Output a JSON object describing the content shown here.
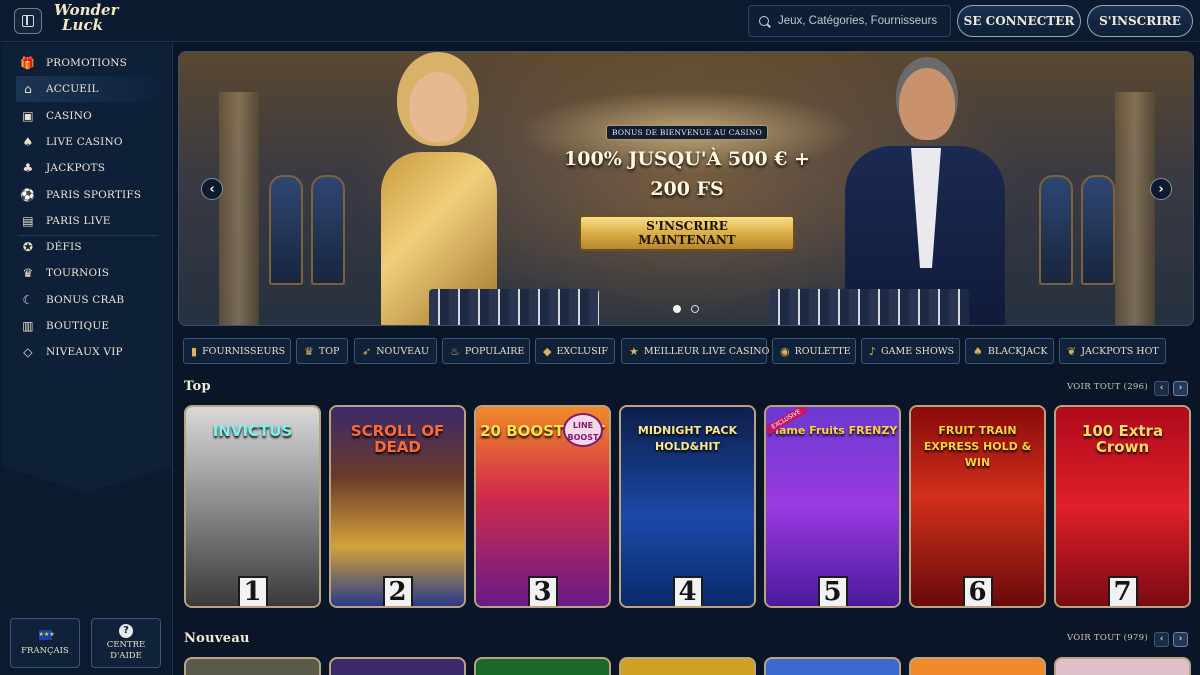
{
  "header": {
    "logo_line1": "Wonder",
    "logo_line2": "Luck",
    "search_placeholder": "Jeux, Catégories, Fournisseurs",
    "login_label": "SE CONNECTER",
    "register_label": "S'INSCRIRE"
  },
  "sidebar": {
    "items": [
      {
        "label": "PROMOTIONS",
        "icon": "gift-icon"
      },
      {
        "label": "ACCUEIL",
        "icon": "home-icon"
      },
      {
        "label": "CASINO",
        "icon": "slot-machine-icon"
      },
      {
        "label": "LIVE CASINO",
        "icon": "cards-icon"
      },
      {
        "label": "JACKPOTS",
        "icon": "clover-icon"
      },
      {
        "label": "PARIS SPORTIFS",
        "icon": "ball-icon"
      },
      {
        "label": "PARIS LIVE",
        "icon": "live-icon"
      },
      {
        "label": "DÉFIS",
        "icon": "medal-icon"
      },
      {
        "label": "TOURNOIS",
        "icon": "trophy-icon"
      },
      {
        "label": "BONUS CRAB",
        "icon": "claw-icon"
      },
      {
        "label": "BOUTIQUE",
        "icon": "shop-icon"
      },
      {
        "label": "NIVEAUX VIP",
        "icon": "diamond-icon"
      }
    ],
    "active": "ACCUEIL",
    "language_label": "FRANÇAIS",
    "help_label_line1": "CENTRE",
    "help_label_line2": "D'AIDE"
  },
  "hero": {
    "badge": "BONUS DE BIENVENUE AU CASINO",
    "title_line1": "100% JUSQU'À 500 € +",
    "title_line2": "200 FS",
    "cta_line1": "S'INSCRIRE",
    "cta_line2": "MAINTENANT",
    "slides": 2,
    "current_slide": 1
  },
  "categories": [
    {
      "label": "FOURNISSEURS",
      "icon": "book-icon"
    },
    {
      "label": "TOP",
      "icon": "crown-icon"
    },
    {
      "label": "NOUVEAU",
      "icon": "rocket-icon"
    },
    {
      "label": "POPULAIRE",
      "icon": "fire-icon"
    },
    {
      "label": "EXCLUSIF",
      "icon": "diamond-icon"
    },
    {
      "label": "MEILLEUR LIVE CASINO",
      "icon": "star-icon"
    },
    {
      "label": "ROULETTE",
      "icon": "roulette-icon"
    },
    {
      "label": "GAME SHOWS",
      "icon": "microphone-icon"
    },
    {
      "label": "BLACKJACK",
      "icon": "cards-icon"
    },
    {
      "label": "JACKPOTS HOT",
      "icon": "pepper-icon"
    }
  ],
  "top_section": {
    "title": "Top",
    "see_all": "VOIR TOUT (296)",
    "games": [
      {
        "title": "INVICTUS",
        "rank": "1"
      },
      {
        "title": "SCROLL OF DEAD",
        "rank": "2"
      },
      {
        "title": "20 BOOST HOT",
        "rank": "3",
        "tag": "LINE BOOST"
      },
      {
        "title": "MIDNIGHT PACK HOLD&HIT",
        "rank": "4"
      },
      {
        "title": "Flame Fruits FRENZY",
        "rank": "5",
        "badge": "EXCLUSIVE"
      },
      {
        "title": "FRUIT TRAIN EXPRESS HOLD & WIN",
        "rank": "6"
      },
      {
        "title": "100 Extra Crown",
        "rank": "7"
      }
    ]
  },
  "new_section": {
    "title": "Nouveau",
    "see_all": "VOIR TOUT (979)"
  },
  "colors": {
    "background": "#0a1628",
    "accent_gold": "#dcae48",
    "card_border": "#b9a382"
  }
}
